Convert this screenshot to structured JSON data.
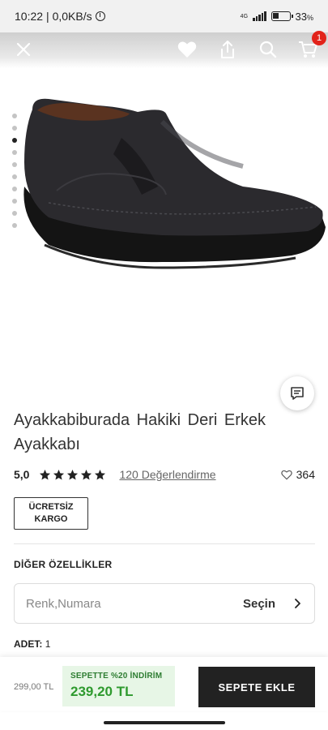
{
  "status_bar": {
    "time": "10:22",
    "speed": "| 0,0KB/s",
    "network": "4G",
    "battery": "33",
    "battery_unit": "%"
  },
  "header": {
    "cart_count": "1"
  },
  "gallery": {
    "image_count": 10,
    "active_index": 3
  },
  "product": {
    "title": "Ayakkabiburada  Hakiki Deri  Erkek Ayakkabı",
    "rating": "5,0",
    "stars": 5,
    "review_link": "120 Değerlendirme",
    "favorite_count": "364",
    "shipping_badge": "ÜCRETSİZ KARGO"
  },
  "options": {
    "section_title": "DİĞER ÖZELLİKLER",
    "placeholder": "Renk,Numara",
    "action": "Seçin"
  },
  "quantity": {
    "label": "ADET:",
    "value": "1"
  },
  "purchase": {
    "old_price": "299,00 TL",
    "promo_label": "SEPETTE %20 İNDİRİM",
    "promo_price": "239,20 TL",
    "cart_button": "SEPETE EKLE"
  },
  "icons": [
    "alarm-icon",
    "signal-icon",
    "battery-icon",
    "close-icon",
    "heart-icon",
    "share-icon",
    "search-icon",
    "cart-icon",
    "chat-icon",
    "star-icon",
    "heart-outline-icon",
    "chevron-right-icon"
  ],
  "colors": {
    "badge": "#e2231a",
    "promo_bg": "#e7f6e6",
    "promo_text": "#2e9a2e",
    "button": "#222222"
  }
}
